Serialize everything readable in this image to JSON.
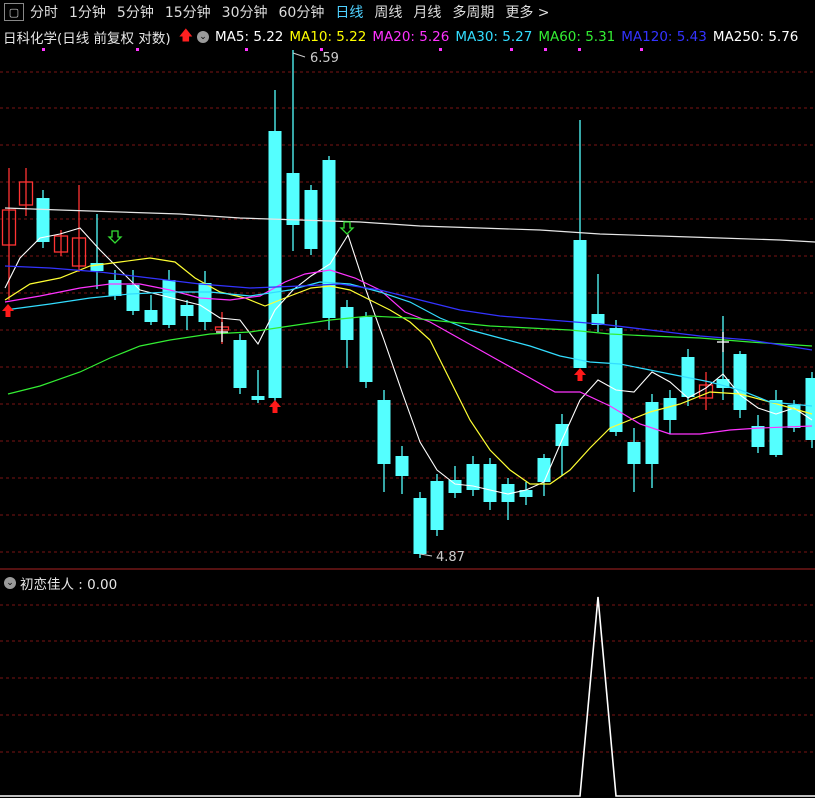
{
  "toolbar": {
    "tabs": [
      {
        "label": "分时",
        "active": false
      },
      {
        "label": "1分钟",
        "active": false
      },
      {
        "label": "5分钟",
        "active": false
      },
      {
        "label": "15分钟",
        "active": false
      },
      {
        "label": "30分钟",
        "active": false
      },
      {
        "label": "60分钟",
        "active": false
      },
      {
        "label": "日线",
        "active": true
      },
      {
        "label": "周线",
        "active": false
      },
      {
        "label": "月线",
        "active": false
      },
      {
        "label": "多周期",
        "active": false
      },
      {
        "label": "更多 >",
        "active": false
      }
    ]
  },
  "info": {
    "stock_label": "日科化学(日线 前复权 对数)",
    "ma": [
      {
        "label": "MA5: 5.22",
        "color": "#ffffff"
      },
      {
        "label": "MA10: 5.22",
        "color": "#ffff00"
      },
      {
        "label": "MA20: 5.26",
        "color": "#ff33ff"
      },
      {
        "label": "MA30: 5.27",
        "color": "#33ddff"
      },
      {
        "label": "MA60: 5.31",
        "color": "#33ee33"
      },
      {
        "label": "MA120: 5.43",
        "color": "#3333ff"
      },
      {
        "label": "MA250: 5.76",
        "color": "#ffffff"
      }
    ]
  },
  "annotations": {
    "high_label": "6.59",
    "low_label": "4.87"
  },
  "sub_indicator": {
    "label": "初恋佳人 : 0.00"
  },
  "colors": {
    "up": "#ff3333",
    "down": "#54ffff",
    "grid": "#7a1515",
    "arrow_up": "#ff1a1a",
    "arrow_down": "#33dd33"
  }
}
